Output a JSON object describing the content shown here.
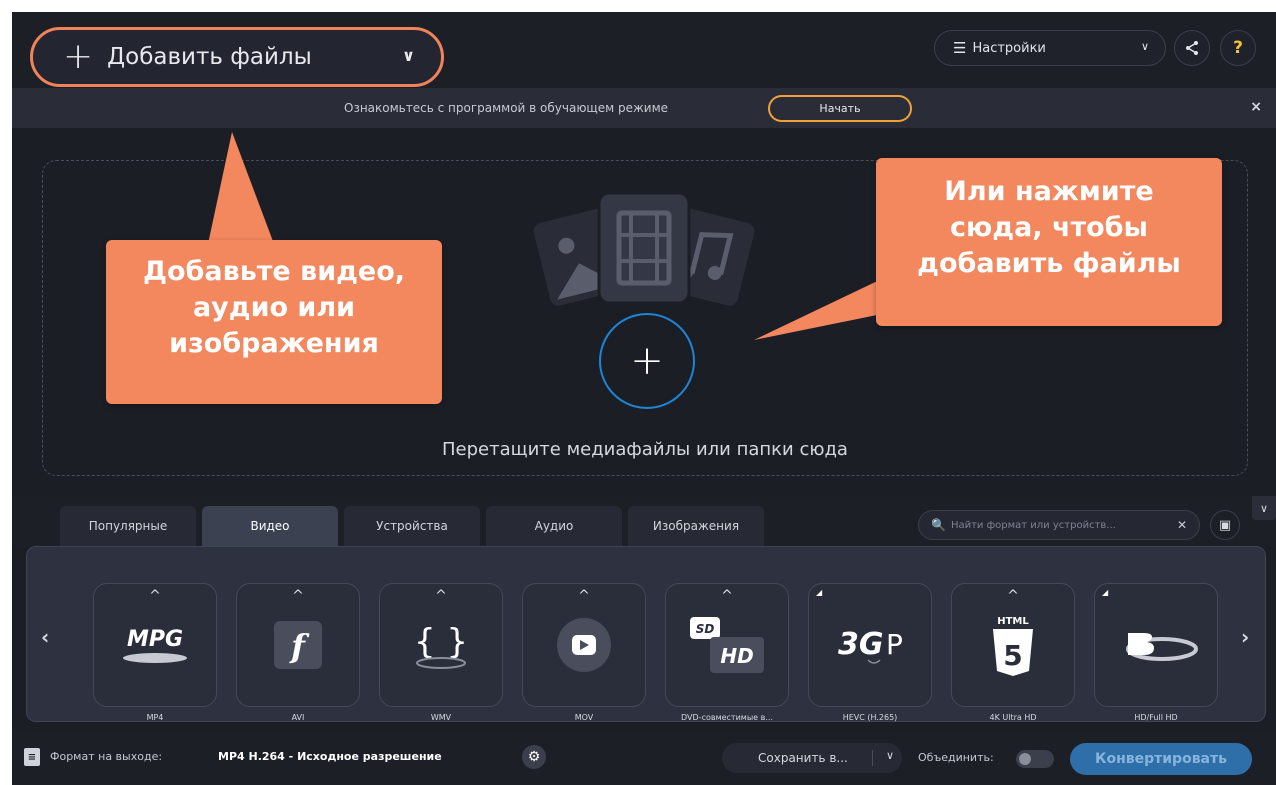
{
  "header": {
    "add_files_label": "Добавить файлы",
    "settings_label": "Настройки"
  },
  "banner": {
    "text": "Ознакомьтесь с программой в обучающем режиме",
    "start_label": "Начать",
    "close_glyph": "×"
  },
  "dropzone": {
    "text": "Перетащите медиафайлы или папки сюда"
  },
  "callouts": {
    "left": [
      "Добавьте видео,",
      "аудио или",
      "изображения"
    ],
    "right": [
      "Или нажмите",
      "сюда, чтобы",
      "добавить файлы"
    ]
  },
  "tabs": [
    {
      "label": "Популярные",
      "active": false
    },
    {
      "label": "Видео",
      "active": true
    },
    {
      "label": "Устройства",
      "active": false
    },
    {
      "label": "Аудио",
      "active": false
    },
    {
      "label": "Изображения",
      "active": false
    }
  ],
  "search": {
    "placeholder": "Найти формат или устройств..."
  },
  "formats": [
    {
      "label": "MP4",
      "icon": "mpg-video-icon"
    },
    {
      "label": "AVI",
      "icon": "flash-icon"
    },
    {
      "label": "WMV",
      "icon": "wmv-braces-icon"
    },
    {
      "label": "MOV",
      "icon": "play-button-icon"
    },
    {
      "label": "DVD-совместимые в...",
      "icon": "sd-hd-icon"
    },
    {
      "label": "HEVC (H.265)",
      "icon": "3gp-icon"
    },
    {
      "label": "4K Ultra HD",
      "icon": "html5-icon"
    },
    {
      "label": "HD/Full HD",
      "icon": "bluray-icon"
    }
  ],
  "status": {
    "output_label": "Формат на выходе:",
    "output_value": "MP4 H.264 - Исходное разрешение",
    "save_label": "Сохранить в...",
    "merge_label": "Объединить:",
    "convert_label": "Конвертировать"
  },
  "colors": {
    "accent_orange": "#f3875e",
    "accent_blue": "#1e84d4",
    "background": "#1c1e26"
  }
}
